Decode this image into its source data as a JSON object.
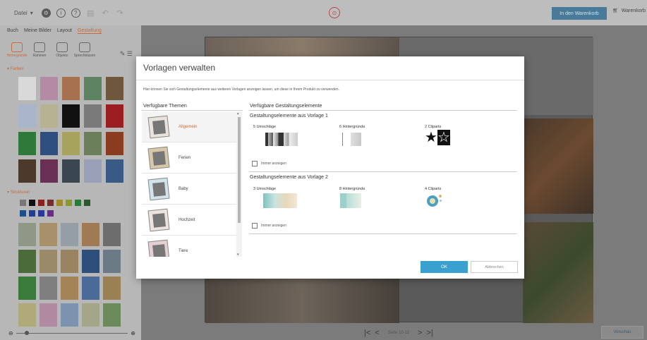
{
  "topbar": {
    "file_menu": "Datei",
    "cart_button": "In den Warenkorb",
    "cart_label": "Warenkorb"
  },
  "left_panel": {
    "tabs": [
      "Buch",
      "Meine Bilder",
      "Layout",
      "Gestaltung"
    ],
    "tools": [
      "Hintergründe",
      "Rahmen",
      "Objekte",
      "Sprechblasen"
    ],
    "section_colors": "Farben",
    "section_textures": "Strukturen",
    "swatches": [
      "#d9d9d9",
      "#b48aa4",
      "#a7704f",
      "#5e8360",
      "#6f573c",
      "#a9b6c9",
      "#b7b392",
      "#111111",
      "#7a7a7a",
      "#9b1f22",
      "#2f7a3a",
      "#2e4f80",
      "#a7a35d",
      "#6b7f5a",
      "#8a3c1f",
      "#4b3a2b",
      "#6a2f55",
      "#3a4750",
      "#9aa0b8",
      "#3a5a86"
    ],
    "mini_swatches": [
      "#777777",
      "#111111",
      "#8a1f1f",
      "#7a2a2a",
      "#a08a2a",
      "#8a9a2a",
      "#2a7a3a",
      "#2a5a2a",
      "#1f4f8a",
      "#1f3f9a",
      "#2a3a9a",
      "#6a2a8a"
    ],
    "textures": [
      "#8f9886",
      "#a8906a",
      "#959da6",
      "#a07a55",
      "#6d6d6d",
      "#4b6b3a",
      "#9a8a6a",
      "#9a8360",
      "#2d4f7a",
      "#6b7a86",
      "#3a7a3a",
      "#7f7f7f",
      "#a48457",
      "#4a6a9a",
      "#9a8055",
      "#b0aa7a",
      "#b08aa0",
      "#7c93b0",
      "#a5a58a",
      "#6a8a5a"
    ]
  },
  "canvas": {
    "page_indicator": "Seite 10-11",
    "preview_button": "Vorschau"
  },
  "modal": {
    "title": "Vorlagen verwalten",
    "description": "Hier können Sie sich Gestaltungselemente aus weiteren Vorlagen anzeigen lassen, um diese in Ihrem Produkt zu verwenden.",
    "left_heading": "Verfügbare Themen",
    "right_heading": "Verfügbare Gestaltungselemente",
    "themes": [
      {
        "label": "Allgemein"
      },
      {
        "label": "Ferien"
      },
      {
        "label": "Baby"
      },
      {
        "label": "Hochzeit"
      },
      {
        "label": "Tiere"
      }
    ],
    "groups": [
      {
        "title": "Gestaltungselemente aus Vorlage 1",
        "col1": "5 Umschläge",
        "col2": "6 Hintergründe",
        "col3": "2 Cliparts",
        "checkbox": "Immer anzeigen"
      },
      {
        "title": "Gestaltungselemente aus Vorlage 2",
        "col1": "3 Umschläge",
        "col2": "8 Hintergründe",
        "col3": "4 Cliparts",
        "checkbox": "Immer anzeigen"
      }
    ],
    "ok_button": "OK",
    "cancel_button": "Abbrechen"
  }
}
